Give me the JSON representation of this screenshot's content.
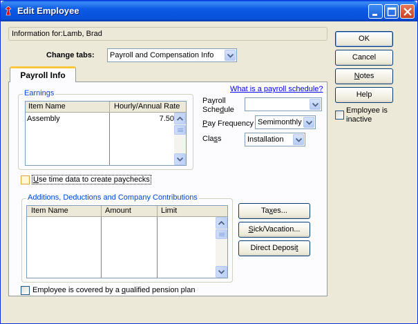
{
  "window": {
    "title": "Edit Employee"
  },
  "info": {
    "label": "Information for:",
    "employee_name": "Lamb, Brad"
  },
  "change_tabs": {
    "label": "Change tabs:",
    "selected": "Payroll and Compensation Info"
  },
  "tab": {
    "label": "Payroll Info"
  },
  "earnings": {
    "title": "Earnings",
    "columns": [
      "Item Name",
      "Hourly/Annual Rate"
    ],
    "rows": [
      {
        "item": "Assembly",
        "rate": "7.50"
      }
    ]
  },
  "payroll_schedule": {
    "link": "What is a payroll schedule?",
    "label_line1": "Payroll",
    "label_line2_pre": "Sche",
    "label_line2_ul": "d",
    "label_line2_post": "ule",
    "value": ""
  },
  "pay_frequency": {
    "label_ul": "P",
    "label_post": "ay Frequency",
    "value": "Semimonthly"
  },
  "class": {
    "label_pre": "Cla",
    "label_ul": "s",
    "label_post": "s",
    "value": "Installation"
  },
  "time_data": {
    "label_ul": "U",
    "label_post": "se time data to create paychecks",
    "checked": false
  },
  "additions": {
    "title": "Additions, Deductions and Company Contributions",
    "columns": [
      "Item Name",
      "Amount",
      "Limit"
    ]
  },
  "side_buttons": {
    "taxes_pre": "Ta",
    "taxes_ul": "x",
    "taxes_post": "es...",
    "sick_ul": "S",
    "sick_post": "ick/Vacation...",
    "direct_pre": "Direct Deposi",
    "direct_ul": "t"
  },
  "pension": {
    "label_pre": "Employee is covered by a ",
    "label_ul": "q",
    "label_post": "ualified pension plan",
    "checked": false
  },
  "right_buttons": {
    "ok": "OK",
    "cancel": "Cancel",
    "notes_ul": "N",
    "notes_post": "otes",
    "help": "Help"
  },
  "inactive": {
    "label_line1": "Employee is",
    "label_line2": "inactive",
    "checked": false
  },
  "colors": {
    "title_bar": "#0a58e4",
    "link": "#0000ff",
    "group_title": "#0046d5",
    "tab_accent": "#ffc83c"
  }
}
